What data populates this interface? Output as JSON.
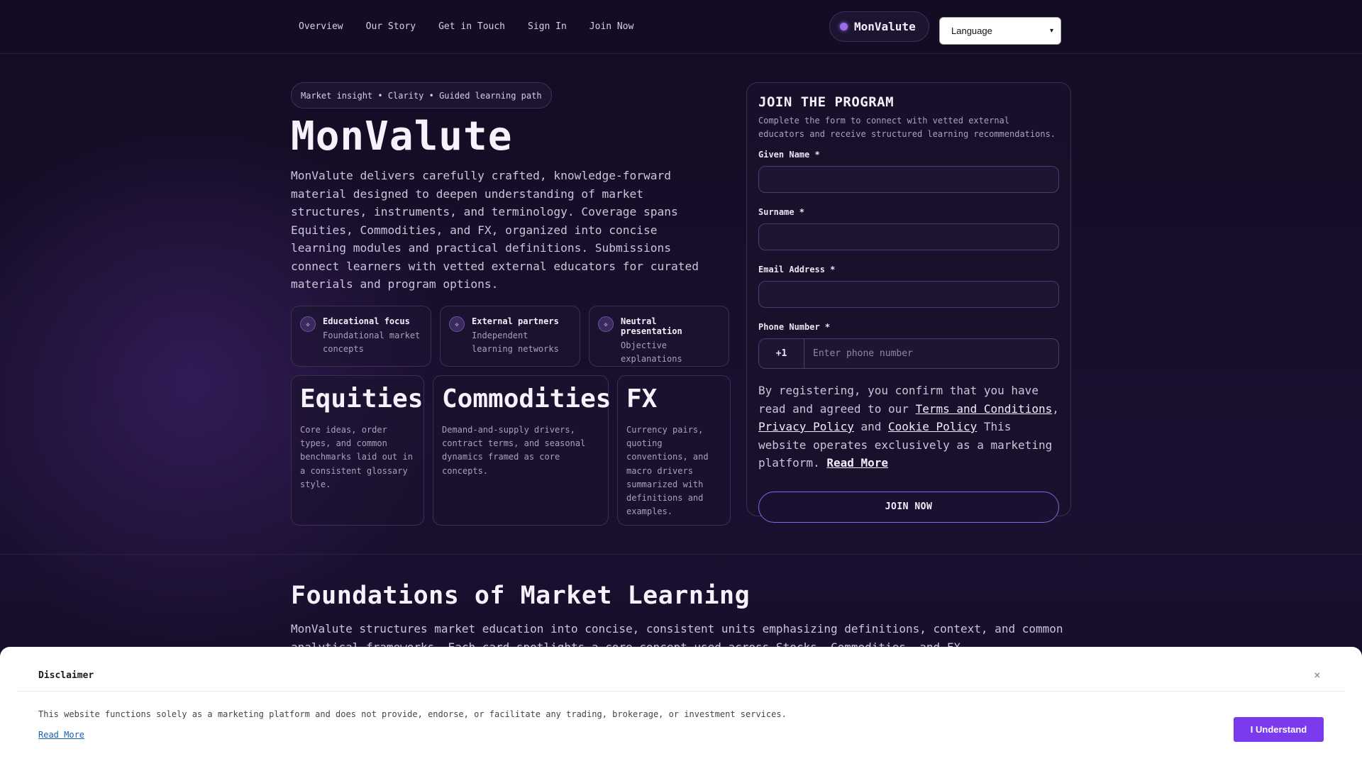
{
  "nav": {
    "links": [
      "Overview",
      "Our Story",
      "Get in Touch",
      "Sign In",
      "Join Now"
    ],
    "brand": "MonValute",
    "language_label": "Language"
  },
  "hero": {
    "tagline": "Market insight • Clarity • Guided learning path",
    "title": "MonValute",
    "description": "MonValute delivers carefully crafted, knowledge-forward material designed to deepen understanding of market structures, instruments, and terminology. Coverage spans Equities, Commodities, and FX, organized into concise learning modules and practical definitions. Submissions connect learners with vetted external educators for curated materials and program options.",
    "features": [
      {
        "title": "Educational focus",
        "subtitle": "Foundational market concepts",
        "icon": "sparkle-icon"
      },
      {
        "title": "External partners",
        "subtitle": "Independent learning networks",
        "icon": "sparkle-icon"
      },
      {
        "title": "Neutral presentation",
        "subtitle": "Objective explanations",
        "icon": "sparkle-icon"
      }
    ],
    "markets": [
      {
        "title": "Equities",
        "description": "Core ideas, order types, and common benchmarks laid out in a consistent glossary style."
      },
      {
        "title": "Commodities",
        "description": "Demand-and-supply drivers, contract terms, and seasonal dynamics framed as core concepts."
      },
      {
        "title": "FX",
        "description": "Currency pairs, quoting conventions, and macro drivers summarized with definitions and examples."
      }
    ]
  },
  "form": {
    "title": "JOIN THE PROGRAM",
    "subtitle": "Complete the form to connect with vetted external educators and receive structured learning recommendations.",
    "given_name_label": "Given Name *",
    "surname_label": "Surname *",
    "email_label": "Email Address *",
    "phone_label": "Phone Number *",
    "phone_code": "+1",
    "phone_placeholder": "Enter phone number",
    "legal_prefix": "By registering, you confirm that you have read and agreed to our ",
    "terms_link": "Terms and Conditions",
    "comma": ", ",
    "privacy_link": "Privacy Policy",
    "and": " and ",
    "cookie_link": "Cookie Policy",
    "legal_suffix": " This website operates exclusively as a marketing platform. ",
    "read_more": "Read More",
    "submit_label": "JOIN NOW"
  },
  "foundations": {
    "title": "Foundations of Market Learning",
    "description": "MonValute structures market education into concise, consistent units emphasizing definitions, context, and common analytical frameworks. Each card spotlights a core concept used across Stocks, Commodities, and FX."
  },
  "disclaimer": {
    "title": "Disclaimer",
    "text": "This website functions solely as a marketing platform and does not provide, endorse, or facilitate any trading, brokerage, or investment services.",
    "link": "Read More",
    "button": "I Understand",
    "close": "×"
  },
  "colors": {
    "accent": "#7c3aed",
    "background": "#140d24",
    "brand_dot": "#9b6bea"
  }
}
